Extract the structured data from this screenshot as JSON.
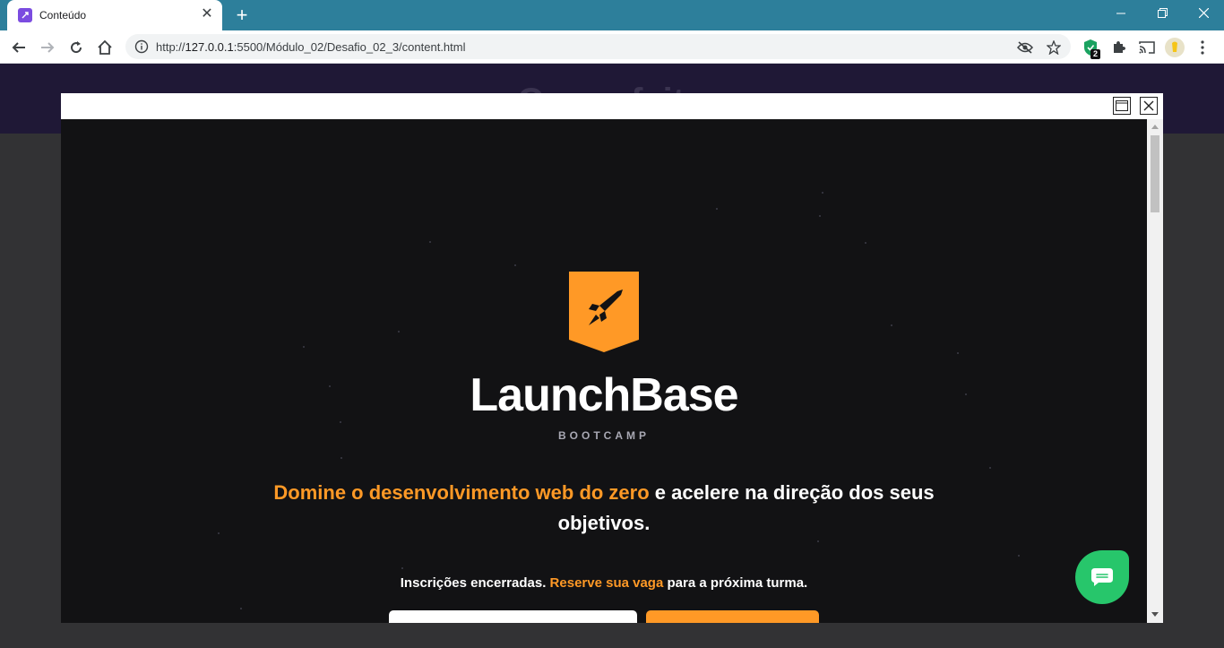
{
  "browser": {
    "tab_title": "Conteúdo",
    "url_prefix": "http://",
    "url_host": "127.0.0.1",
    "url_path": ":5500/Módulo_02/Desafio_02_3/content.html",
    "extension_badge": "2"
  },
  "page": {
    "header_title": "Curso feito"
  },
  "modal": {
    "brand": "LaunchBase",
    "subtitle": "BOOTCAMP",
    "headline_highlight": "Domine o desenvolvimento web do zero",
    "headline_rest": " e acelere na direção dos seus objetivos.",
    "enroll_closed": "Inscrições encerradas.",
    "enroll_link": "Reserve sua vaga",
    "enroll_rest": "para a próxima turma.",
    "accent_color": "#ff9926",
    "background_color": "#121214"
  },
  "icons": {
    "back": "arrow-left-icon",
    "forward": "arrow-right-icon",
    "reload": "reload-icon",
    "home": "home-icon",
    "chat": "chat-bubble-icon"
  }
}
